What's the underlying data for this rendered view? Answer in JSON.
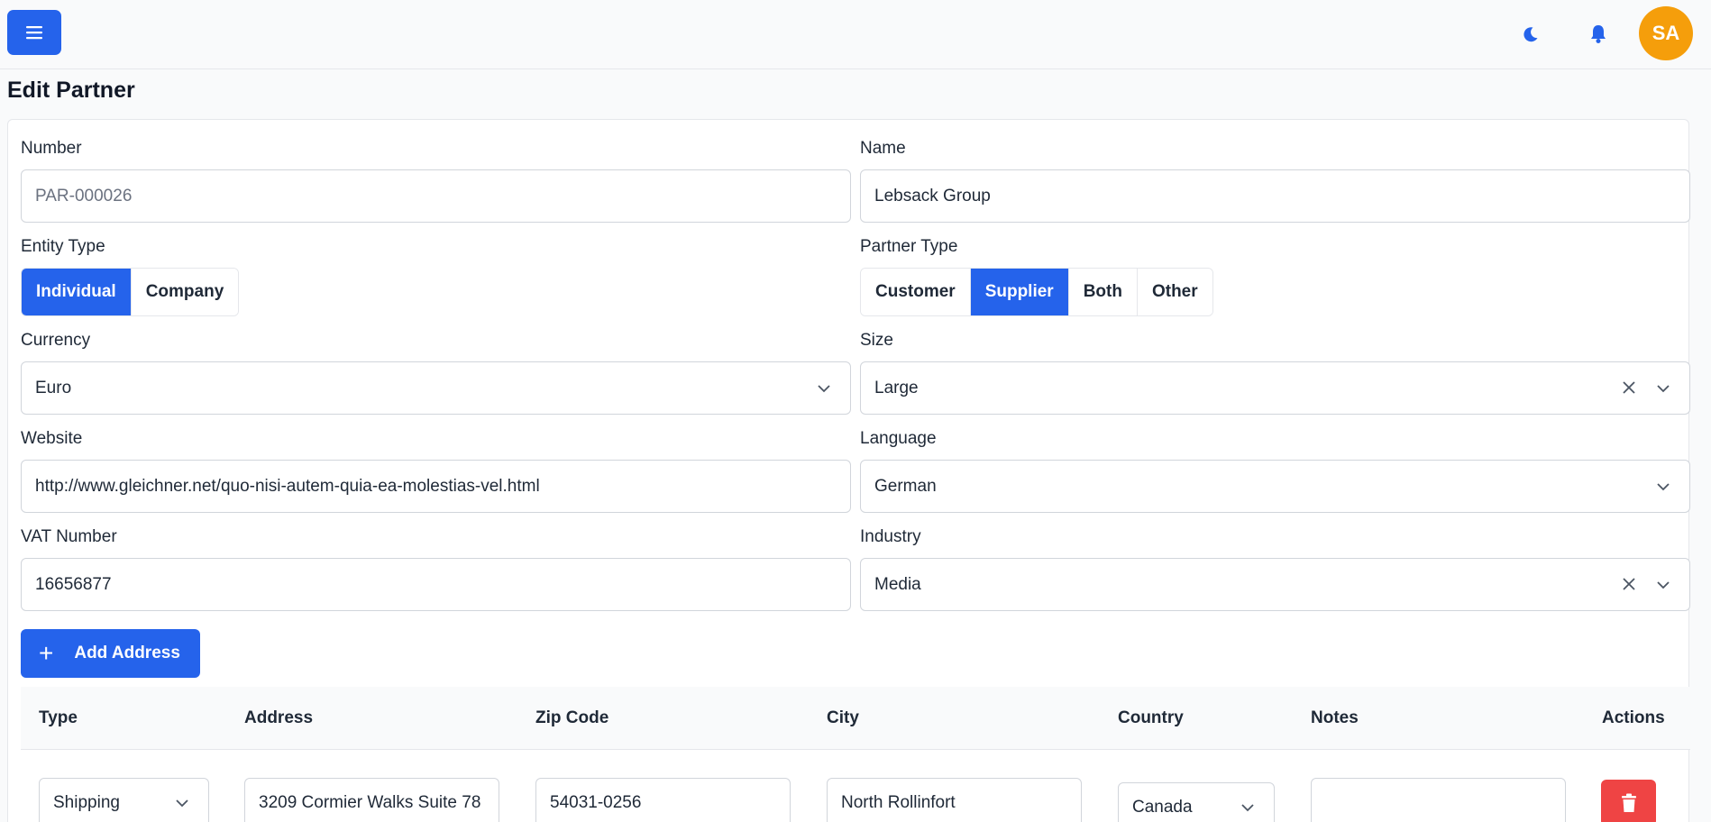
{
  "header": {
    "menu_icon": "hamburger-icon",
    "theme_icon": "moon-icon",
    "notification_icon": "bell-icon",
    "avatar_initials": "SA",
    "accent_color": "#2563eb",
    "avatar_color": "#f59e0b"
  },
  "page": {
    "title": "Edit Partner"
  },
  "form": {
    "number": {
      "label": "Number",
      "value": "PAR-000026"
    },
    "name": {
      "label": "Name",
      "value": "Lebsack Group"
    },
    "entity_type": {
      "label": "Entity Type",
      "options": [
        "Individual",
        "Company"
      ],
      "selected": "Individual"
    },
    "partner_type": {
      "label": "Partner Type",
      "options": [
        "Customer",
        "Supplier",
        "Both",
        "Other"
      ],
      "selected": "Supplier"
    },
    "currency": {
      "label": "Currency",
      "value": "Euro"
    },
    "size": {
      "label": "Size",
      "value": "Large"
    },
    "website": {
      "label": "Website",
      "value": "http://www.gleichner.net/quo-nisi-autem-quia-ea-molestias-vel.html"
    },
    "language": {
      "label": "Language",
      "value": "German"
    },
    "vat_number": {
      "label": "VAT Number",
      "value": "16656877"
    },
    "industry": {
      "label": "Industry",
      "value": "Media"
    },
    "add_address_label": "Add Address"
  },
  "addresses": {
    "columns": [
      "Type",
      "Address",
      "Zip Code",
      "City",
      "Country",
      "Notes",
      "Actions"
    ],
    "rows": [
      {
        "type": "Shipping",
        "address": "3209 Cormier Walks Suite 78",
        "zip": "54031-0256",
        "city": "North Rollinfort",
        "country": "Canada",
        "notes": "",
        "delete_icon": "trash-icon",
        "delete_color": "#ef4444"
      }
    ]
  }
}
